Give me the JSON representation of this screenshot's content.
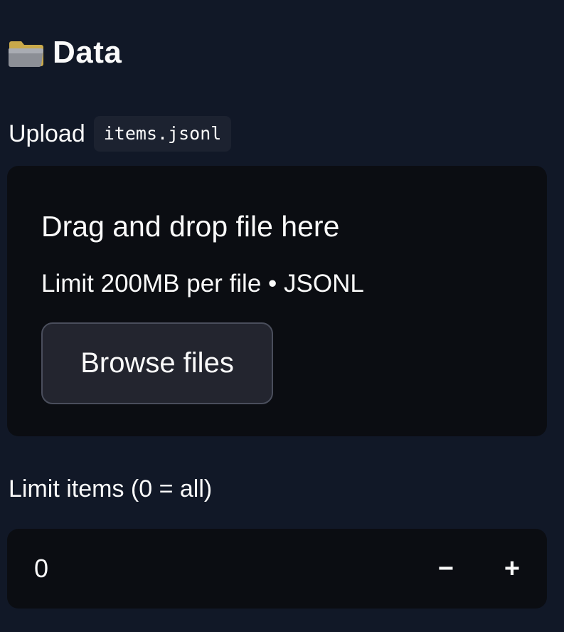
{
  "section": {
    "icon": "folder-icon",
    "title": "Data"
  },
  "upload": {
    "label": "Upload",
    "filename": "items.jsonl",
    "dropzone_title": "Drag and drop file here",
    "dropzone_limit": "Limit 200MB per file • JSONL",
    "browse_label": "Browse files"
  },
  "limit_items": {
    "label": "Limit items (0 = all)",
    "value": "0",
    "decrement_label": "−",
    "increment_label": "+"
  },
  "colors": {
    "background": "#111827",
    "panel": "#0b0d12",
    "button": "#23252f",
    "text": "#fafafa"
  }
}
